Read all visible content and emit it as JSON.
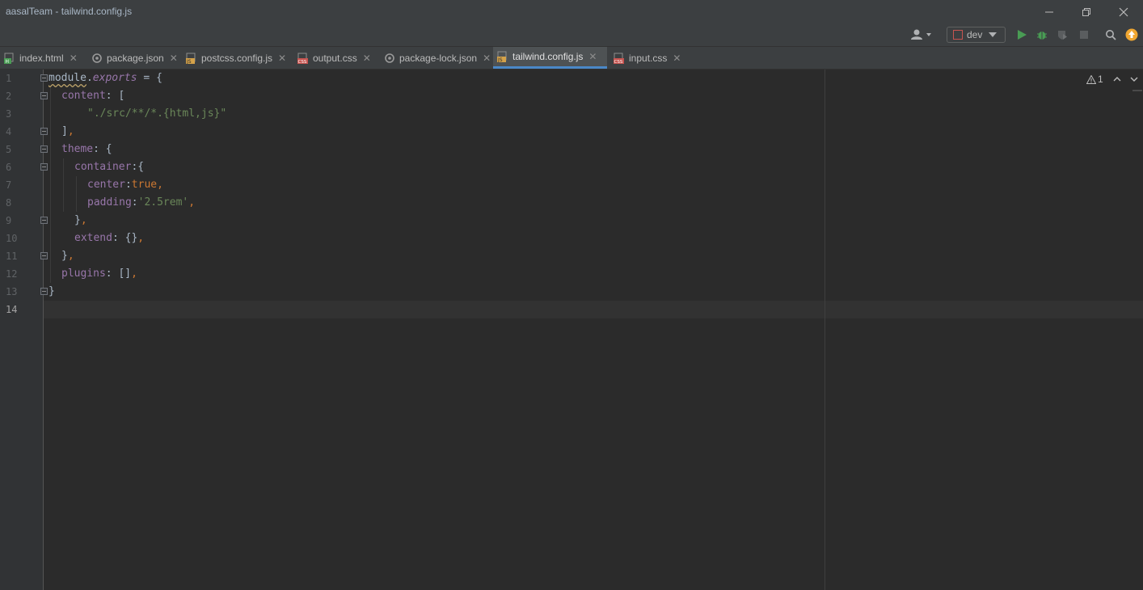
{
  "window": {
    "title": "aasalTeam - tailwind.config.js"
  },
  "toolbar": {
    "run_config": "dev"
  },
  "tabs": [
    {
      "label": "index.html",
      "type": "html",
      "active": false
    },
    {
      "label": "package.json",
      "type": "json",
      "active": false
    },
    {
      "label": "postcss.config.js",
      "type": "js",
      "active": false
    },
    {
      "label": "output.css",
      "type": "css",
      "active": false
    },
    {
      "label": "package-lock.json",
      "type": "json",
      "active": false
    },
    {
      "label": "tailwind.config.js",
      "type": "js",
      "active": true
    },
    {
      "label": "input.css",
      "type": "css",
      "active": false
    }
  ],
  "editor": {
    "inspection_count": "1",
    "line_numbers": [
      "1",
      "2",
      "3",
      "4",
      "5",
      "6",
      "7",
      "8",
      "9",
      "10",
      "11",
      "12",
      "13",
      "14"
    ],
    "code": {
      "l1_module": "module",
      "l1_dot": ".",
      "l1_exports": "exports",
      "l1_rest": " = {",
      "l2_key": "content",
      "l2_rest": ": [",
      "l3_str": "\"./src/**/*.{html,js}\"",
      "l4_bracket": "]",
      "l4_comma": ",",
      "l5_key": "theme",
      "l5_rest": ": {",
      "l6_key": "container",
      "l6_rest": ":{",
      "l7_key": "center",
      "l7_colon": ":",
      "l7_val": "true",
      "l7_comma": ",",
      "l8_key": "padding",
      "l8_colon": ":",
      "l8_val": "'2.5rem'",
      "l8_comma": ",",
      "l9_brace": "}",
      "l9_comma": ",",
      "l10_key": "extend",
      "l10_rest": ": {}",
      "l10_comma": ",",
      "l11_brace": "}",
      "l11_comma": ",",
      "l12_key": "plugins",
      "l12_rest": ": []",
      "l12_comma": ",",
      "l13_brace": "}"
    }
  },
  "colors": {
    "background": "#2b2b2b",
    "chrome": "#3c3f41",
    "accent_tab_underline": "#4a88c7",
    "property": "#9876aa",
    "keyword": "#cc7832",
    "string": "#6a8759",
    "run_green": "#499c54",
    "update_badge": "#f0a732"
  },
  "icons": {
    "minimize": "minimize-icon",
    "restore": "restore-icon",
    "close": "close-icon",
    "user": "user-icon",
    "run": "run-icon",
    "debug": "debug-icon",
    "coverage": "coverage-icon",
    "stop": "stop-icon",
    "search": "search-icon",
    "update": "update-icon"
  }
}
